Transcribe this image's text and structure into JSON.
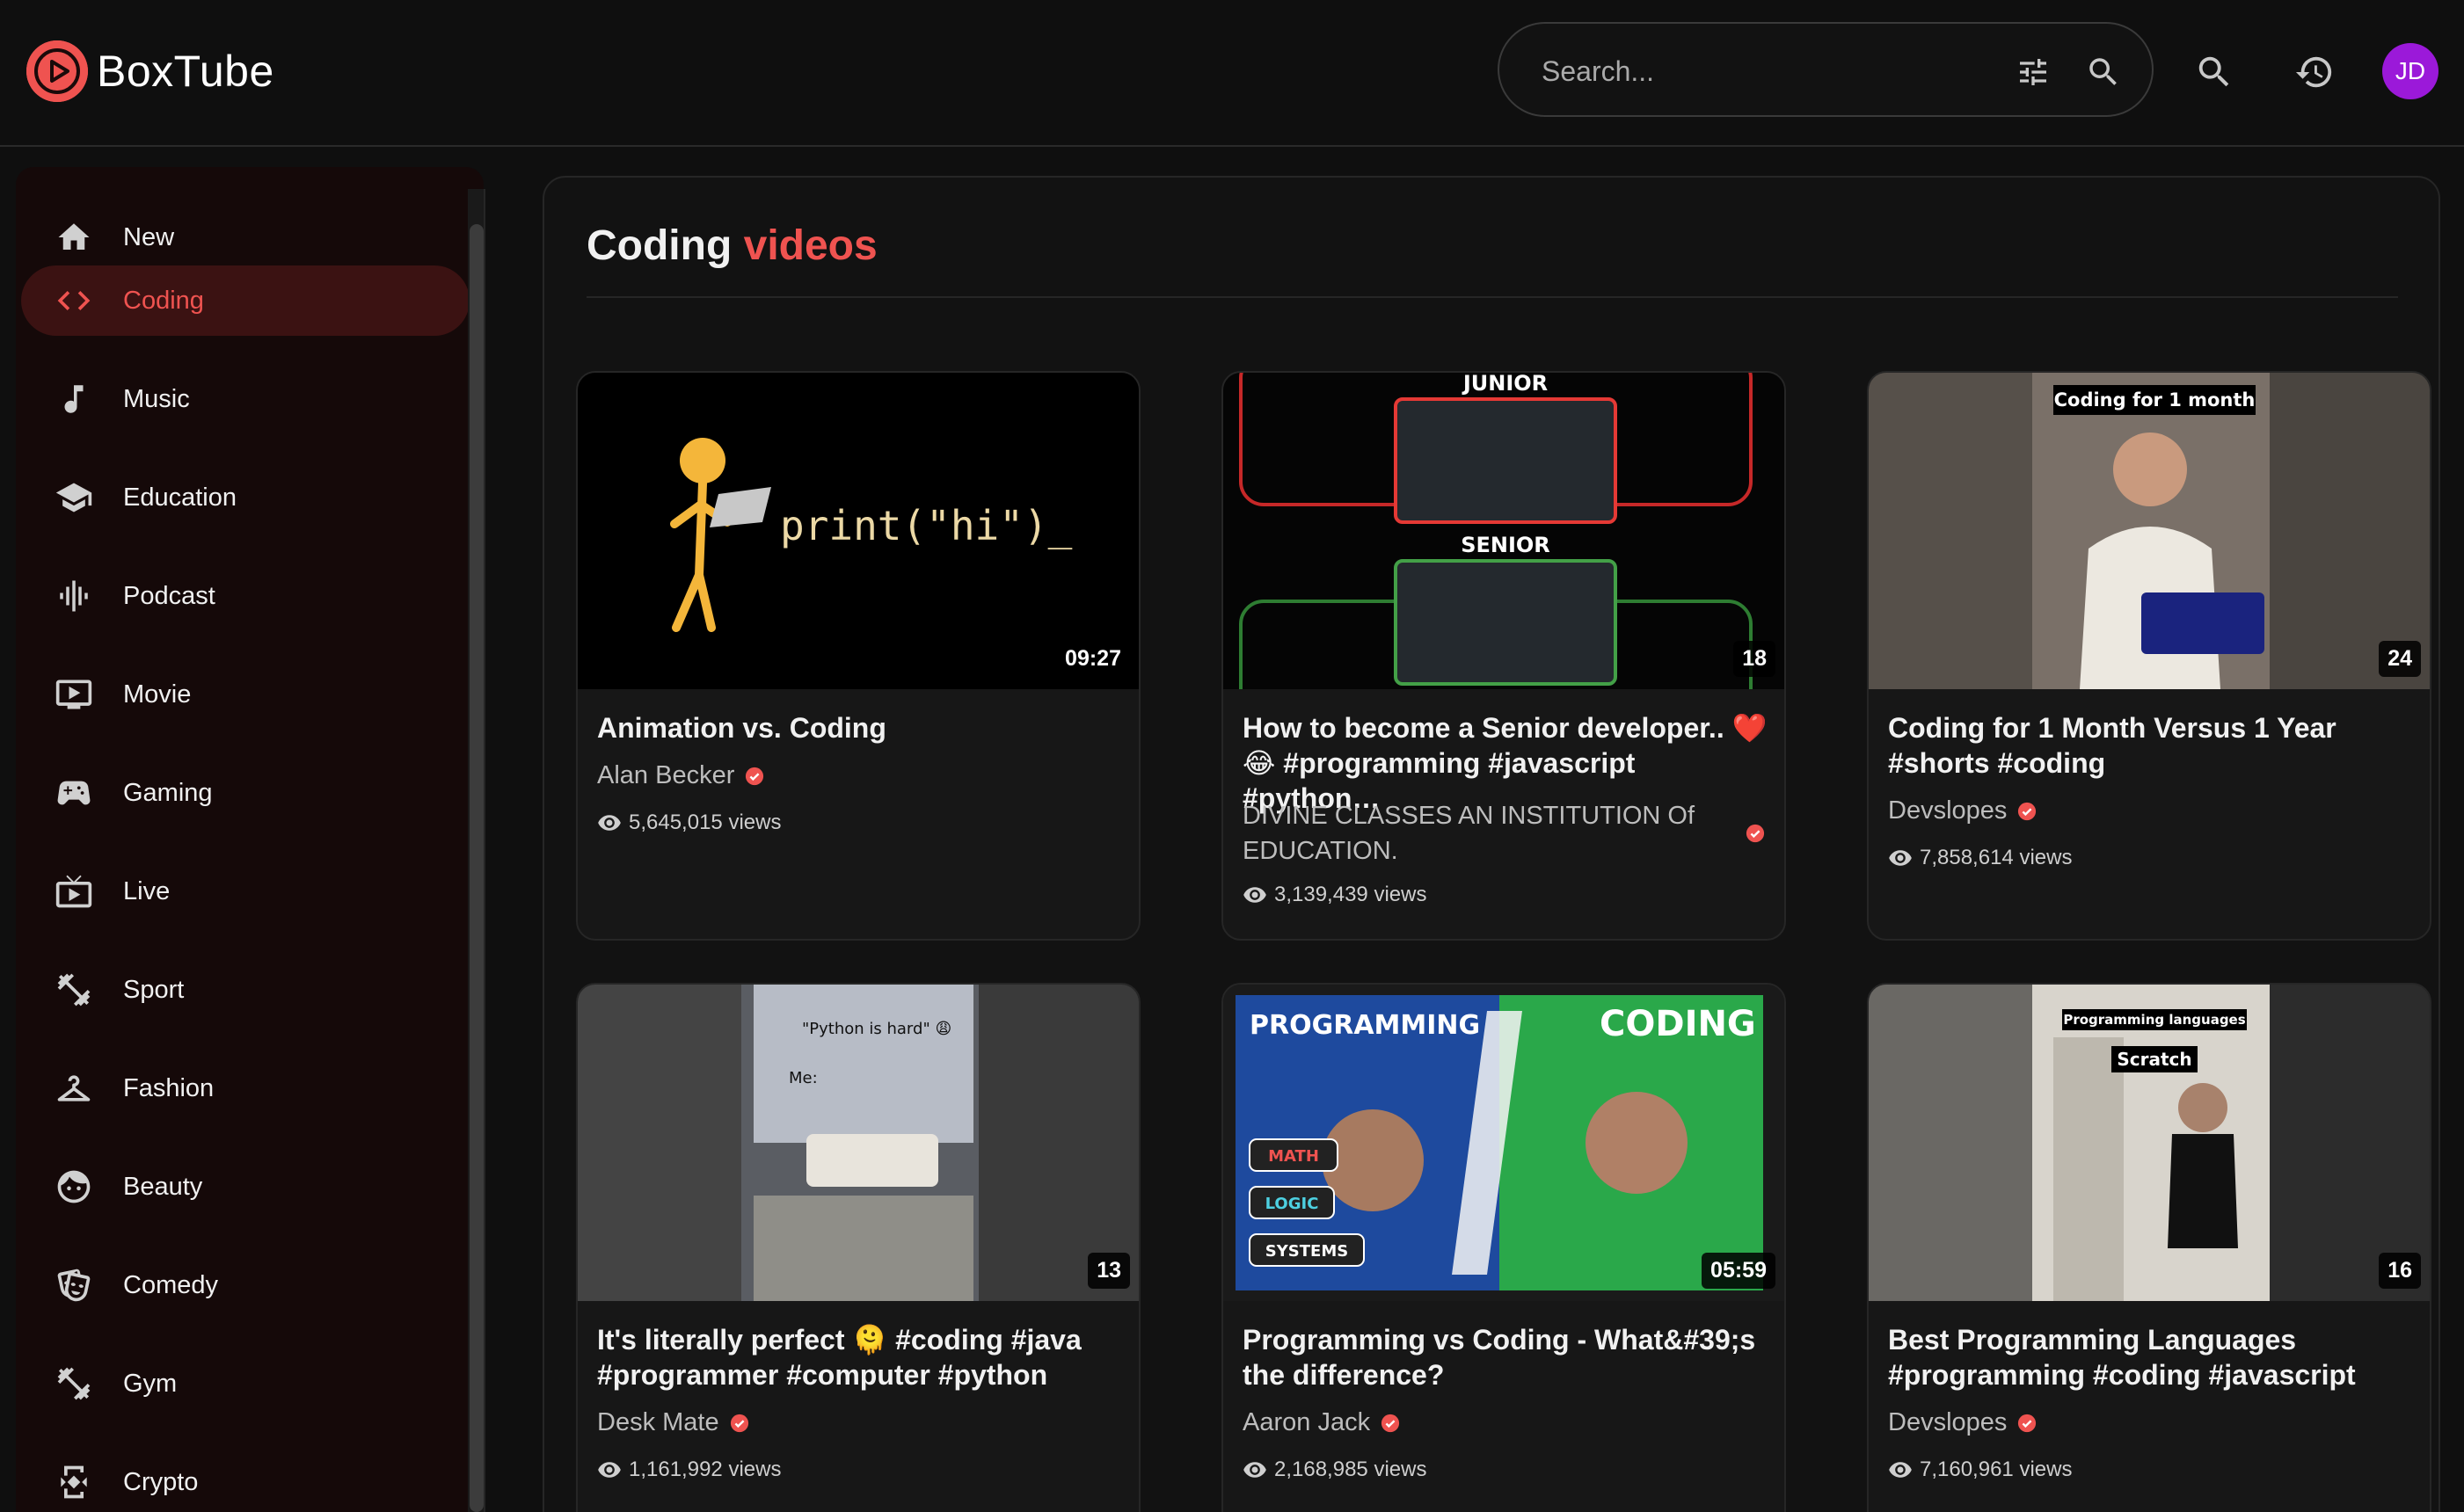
{
  "app": {
    "name": "BoxTube",
    "accent": "#ef5350"
  },
  "header": {
    "search_placeholder": "Search...",
    "avatar_initials": "JD",
    "avatar_color": "#9b19d9",
    "icons": [
      "tune-icon",
      "search-icon",
      "search-icon",
      "history-icon"
    ]
  },
  "sidebar": {
    "items": [
      {
        "label": "New",
        "icon": "home-icon",
        "active": false
      },
      {
        "label": "Coding",
        "icon": "code-icon",
        "active": true
      },
      {
        "label": "Music",
        "icon": "music-note-icon",
        "active": false
      },
      {
        "label": "Education",
        "icon": "graduation-cap-icon",
        "active": false
      },
      {
        "label": "Podcast",
        "icon": "graphic-eq-icon",
        "active": false
      },
      {
        "label": "Movie",
        "icon": "video-player-icon",
        "active": false
      },
      {
        "label": "Gaming",
        "icon": "gamepad-icon",
        "active": false
      },
      {
        "label": "Live",
        "icon": "live-tv-icon",
        "active": false
      },
      {
        "label": "Sport",
        "icon": "dumbbell-icon",
        "active": false
      },
      {
        "label": "Fashion",
        "icon": "hanger-icon",
        "active": false
      },
      {
        "label": "Beauty",
        "icon": "face-icon",
        "active": false
      },
      {
        "label": "Comedy",
        "icon": "theater-masks-icon",
        "active": false
      },
      {
        "label": "Gym",
        "icon": "dumbbell-icon",
        "active": false
      },
      {
        "label": "Crypto",
        "icon": "currency-exchange-icon",
        "active": false
      }
    ]
  },
  "main": {
    "title_prefix": "Coding",
    "title_accent": "videos",
    "videos": [
      {
        "title": "Animation vs. Coding",
        "channel": "Alan Becker",
        "verified": true,
        "views": "5,645,015 views",
        "duration": "09:27",
        "thumb_text": "print(\"hi\")_"
      },
      {
        "title": "How to become a Senior developer.. ❤️ 😂 #programming #javascript #python…",
        "channel": "DIVINE CLASSES AN INSTITUTION Of EDUCATION.",
        "verified": true,
        "views": "3,139,439 views",
        "duration": "18",
        "thumb_label_top": "JUNIOR",
        "thumb_label_bottom": "SENIOR"
      },
      {
        "title": "Coding for 1 Month Versus 1 Year #shorts #coding",
        "channel": "Devslopes",
        "verified": true,
        "views": "7,858,614 views",
        "duration": "24",
        "thumb_caption": "Coding for 1 month"
      },
      {
        "title": "It's literally perfect 🫠 #coding #java #programmer #computer #python",
        "channel": "Desk Mate",
        "verified": true,
        "views": "1,161,992 views",
        "duration": "13",
        "thumb_caption": "\"Python is hard\" 😩",
        "thumb_caption_2": "Me:"
      },
      {
        "title": "Programming vs Coding - What&#39;s the difference?",
        "channel": "Aaron Jack",
        "verified": true,
        "views": "2,168,985 views",
        "duration": "05:59",
        "thumb_left": "PROGRAMMING",
        "thumb_right": "CODING",
        "thumb_tags": [
          "MATH",
          "LOGIC",
          "SYSTEMS"
        ]
      },
      {
        "title": "Best Programming Languages #programming #coding #javascript",
        "channel": "Devslopes",
        "verified": true,
        "views": "7,160,961 views",
        "duration": "16",
        "thumb_caption": "Programming languages",
        "thumb_caption_2": "Scratch"
      }
    ]
  }
}
